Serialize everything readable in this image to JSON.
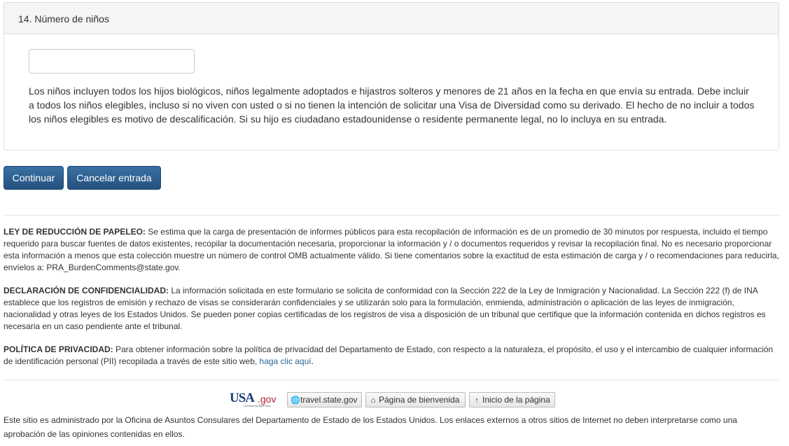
{
  "question": {
    "title": "14. Número de niños",
    "input_value": "",
    "help_text": "Los niños incluyen todos los hijos biológicos, niños legalmente adoptados e hijastros solteros y menores de 21 años en la fecha en que envía su entrada. Debe incluir a todos los niños elegibles, incluso si no viven con usted o si no tienen la intención de solicitar una Visa de Diversidad como su derivado. El hecho de no incluir a todos los niños elegibles es motivo de descalificación. Si su hijo es ciudadano estadounidense o residente permanente legal, no lo incluya en su entrada."
  },
  "actions": {
    "continue_label": "Continuar",
    "cancel_label": "Cancelar entrada"
  },
  "notices": {
    "paperwork": {
      "heading": "LEY DE REDUCCIÓN DE PAPELEO:",
      "text": " Se estima que la carga de presentación de informes públicos para esta recopilación de información es de un promedio de 30 minutos por respuesta, incluido el tiempo requerido para buscar fuentes de datos existentes, recopilar la documentación necesaria, proporcionar la información y / o documentos requeridos y revisar la recopilación final. No es necesario proporcionar esta información a menos que esta colección muestre un número de control OMB actualmente válido. Si tiene comentarios sobre la exactitud de esta estimación de carga y / o recomendaciones para reducirla, envíelos a: PRA_BurdenComments@state.gov."
    },
    "confidentiality": {
      "heading": "DECLARACIÓN DE CONFIDENCIALIDAD:",
      "text": " La información solicitada en este formulario se solicita de conformidad con la Sección 222 de la Ley de Inmigración y Nacionalidad. La Sección 222 (f) de INA establece que los registros de emisión y rechazo de visas se considerarán confidenciales y se utilizarán solo para la formulación, enmienda, administración o aplicación de las leyes de inmigración, nacionalidad y otras leyes de los Estados Unidos. Se pueden poner copias certificadas de los registros de visa a disposición de un tribunal que certifique que la información contenida en dichos registros es necesaria en un caso pendiente ante el tribunal."
    },
    "privacy": {
      "heading": "POLÍTICA DE PRIVACIDAD:",
      "text": " Para obtener información sobre la política de privacidad del Departamento de Estado, con respecto a la naturaleza, el propósito, el uso y el intercambio de cualquier información de identificación personal (PII) recopilada a través de este sitio web, ",
      "link": "haga clic aquí",
      "end": "."
    }
  },
  "footer": {
    "logo_usa": "USA",
    "logo_gov": ".gov",
    "logo_tagline": "Government Made Easy",
    "links": [
      {
        "icon": "globe-icon",
        "label": "travel.state.gov"
      },
      {
        "icon": "home-icon",
        "label": "Página de bienvenida"
      },
      {
        "icon": "arrow-up-icon",
        "label": "Inicio de la página"
      }
    ],
    "admin_text": "Este sitio es administrado por la Oficina de Asuntos Consulares del Departamento de Estado de los Estados Unidos. Los enlaces externos a otros sitios de Internet no deben interpretarse como una aprobación de las opiniones contenidas en ellos."
  },
  "colors": {
    "button": "#2d5f91",
    "link": "#2a6496",
    "logo_blue": "#1c3f7a",
    "logo_red": "#b3242b"
  }
}
